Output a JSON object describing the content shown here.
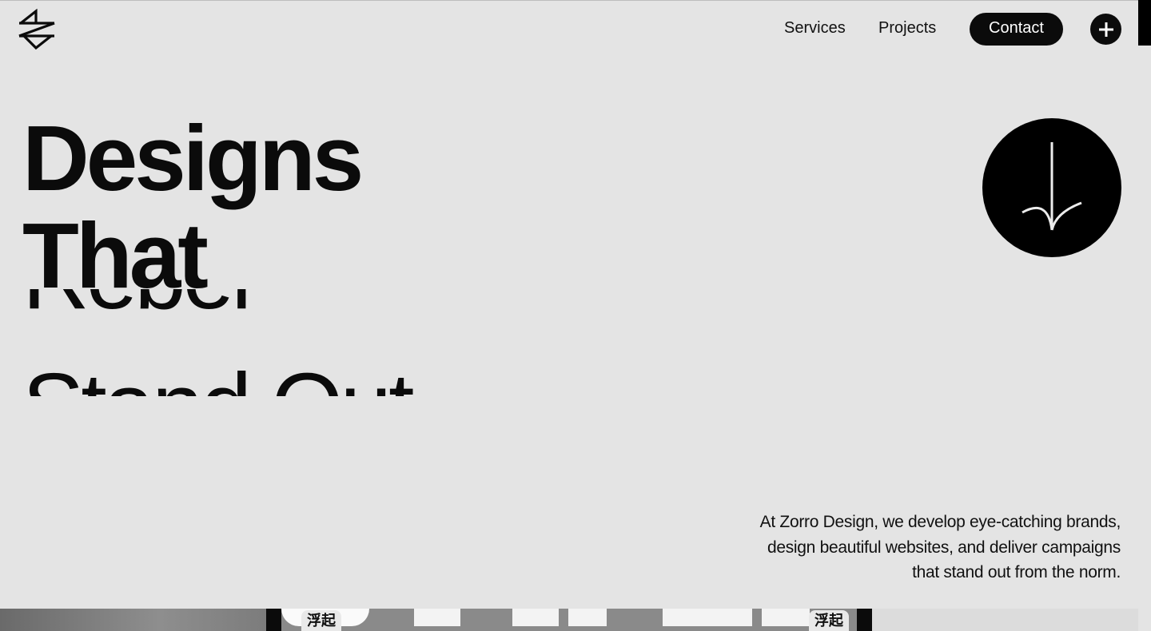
{
  "header": {
    "logo_icon": "zorro-logo-icon",
    "nav": [
      {
        "label": "Services"
      },
      {
        "label": "Projects"
      }
    ],
    "contact_label": "Contact",
    "plus_icon": "plus-icon"
  },
  "hero": {
    "lines": [
      "Designs",
      "That",
      "Rebel",
      "Stand Out"
    ],
    "scroll_icon": "arrow-down-icon"
  },
  "intro": {
    "text": "At Zorro Design, we develop eye-catching brands, design beautiful websites, and deliver campaigns that stand out from the norm."
  },
  "gallery": {
    "can_text": "浮起"
  },
  "colors": {
    "background": "#e4e4e4",
    "primary": "#0b0b0b",
    "button_text": "#ffffff"
  }
}
